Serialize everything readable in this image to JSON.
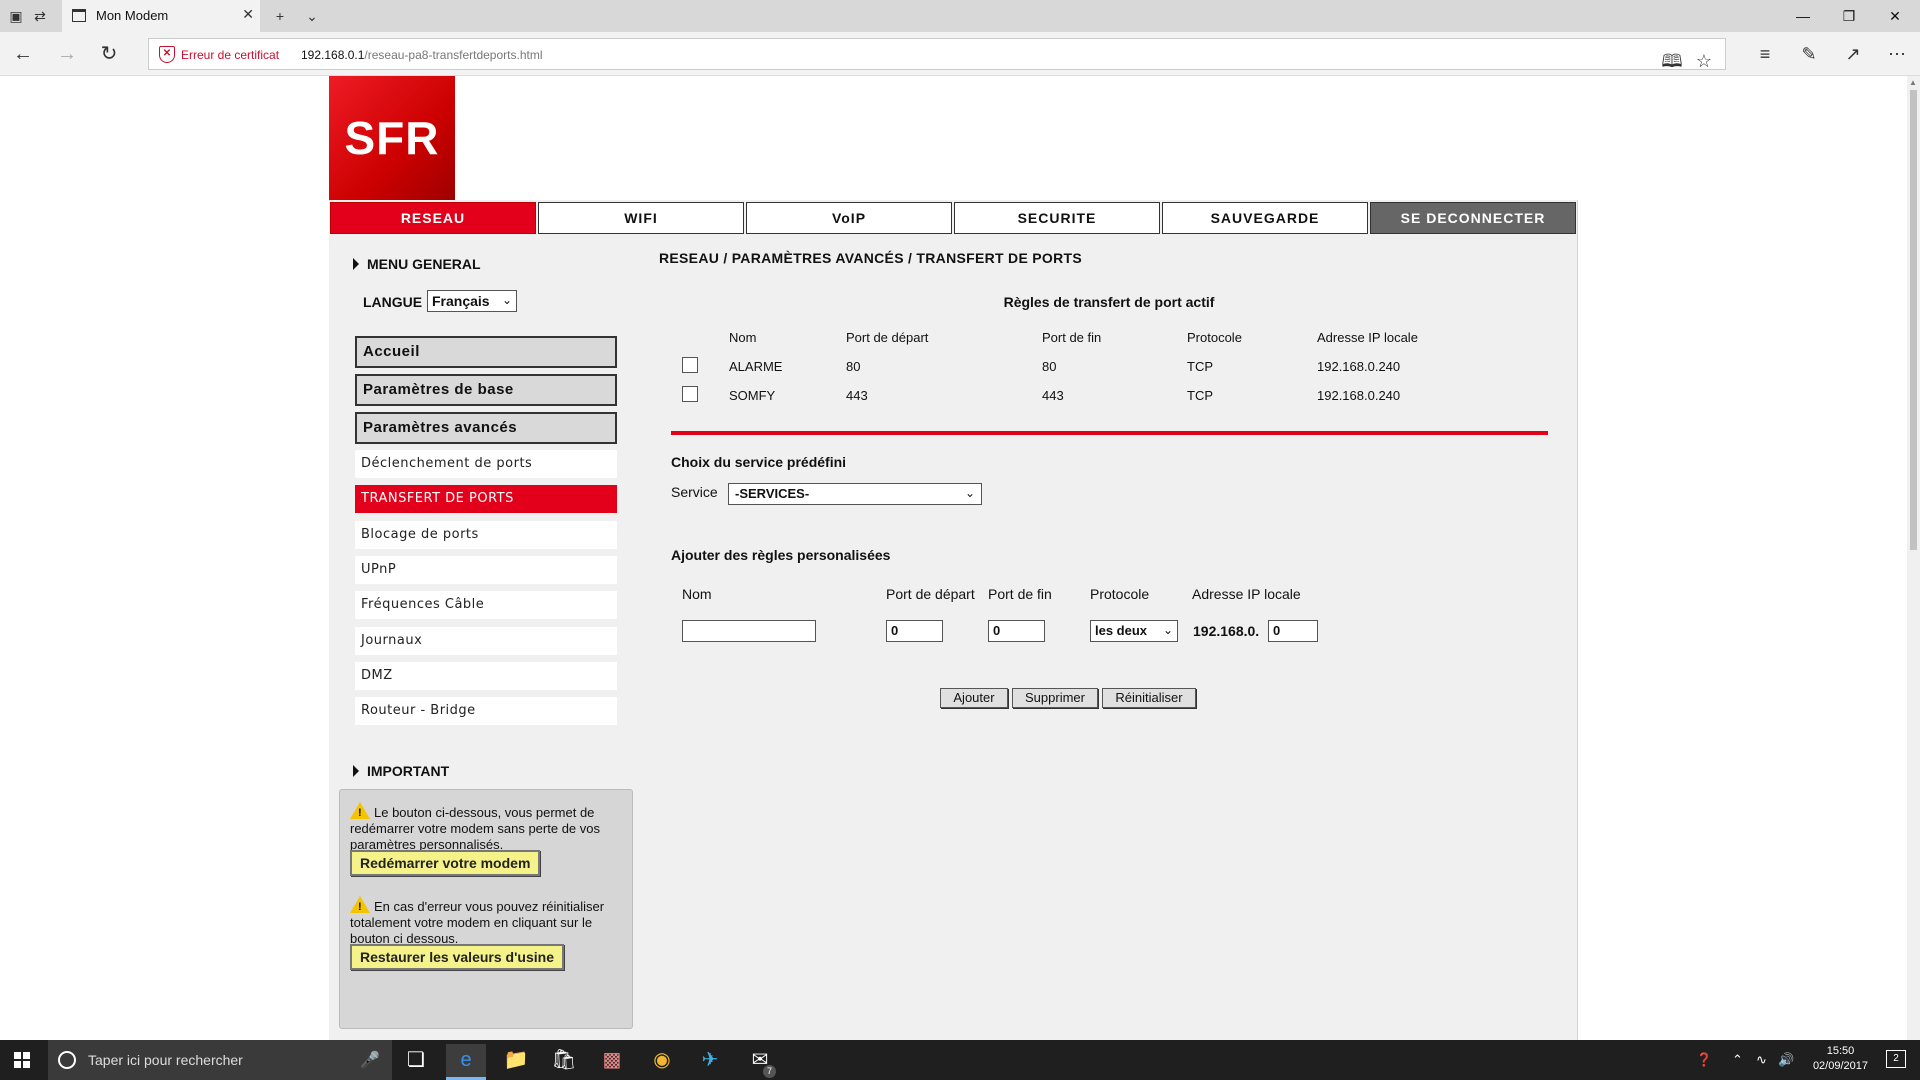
{
  "browser": {
    "tab_title": "Mon Modem",
    "cert_warning": "Erreur de certificat",
    "url_host": "192.168.0.1",
    "url_path": "/reseau-pa8-transfertdeports.html"
  },
  "logo_text": "SFR",
  "nav": [
    "RESEAU",
    "WIFI",
    "VoIP",
    "SECURITE",
    "SAUVEGARDE",
    "SE DECONNECTER"
  ],
  "sidebar": {
    "menu_general": "MENU GENERAL",
    "langue_label": "LANGUE",
    "langue_value": "Français",
    "main_items": [
      "Accueil",
      "Paramètres de base",
      "Paramètres avancés"
    ],
    "sub_items": [
      "Déclenchement de ports",
      "TRANSFERT DE PORTS",
      "Blocage de ports",
      "UPnP",
      "Fréquences Câble",
      "Journaux",
      "DMZ",
      "Routeur - Bridge"
    ],
    "important": "IMPORTANT",
    "warn1": "Le bouton ci-dessous, vous permet de redémarrer votre modem sans perte de vos paramètres personnalisés.",
    "restart_btn": "Redémarrer votre modem",
    "warn2": "En cas d'erreur vous pouvez réinitialiser totalement votre modem en cliquant sur le bouton ci dessous.",
    "factory_btn": "Restaurer les valeurs d'usine"
  },
  "content": {
    "breadcrumb": "RESEAU / PARAMÈTRES AVANCÉS / TRANSFERT DE PORTS",
    "rules_title": "Règles de transfert de port actif",
    "columns": [
      "Nom",
      "Port de départ",
      "Port de fin",
      "Protocole",
      "Adresse IP locale"
    ],
    "rules": [
      {
        "nom": "ALARME",
        "start": "80",
        "end": "80",
        "proto": "TCP",
        "ip": "192.168.0.240"
      },
      {
        "nom": "SOMFY",
        "start": "443",
        "end": "443",
        "proto": "TCP",
        "ip": "192.168.0.240"
      }
    ],
    "service_title": "Choix du service prédéfini",
    "service_label": "Service",
    "service_value": "-SERVICES-",
    "custom_title": "Ajouter des règles personalisées",
    "form_labels": [
      "Nom",
      "Port de départ",
      "Port de fin",
      "Protocole",
      "Adresse IP locale"
    ],
    "form_values": {
      "nom": "",
      "start": "0",
      "end": "0",
      "proto": "les deux",
      "ip_prefix": "192.168.0.",
      "ip_last": "0"
    },
    "buttons": [
      "Ajouter",
      "Supprimer",
      "Réinitialiser"
    ]
  },
  "taskbar": {
    "search_placeholder": "Taper ici pour rechercher",
    "time": "15:50",
    "date": "02/09/2017",
    "mail_badge": "7",
    "notif_count": "2"
  }
}
